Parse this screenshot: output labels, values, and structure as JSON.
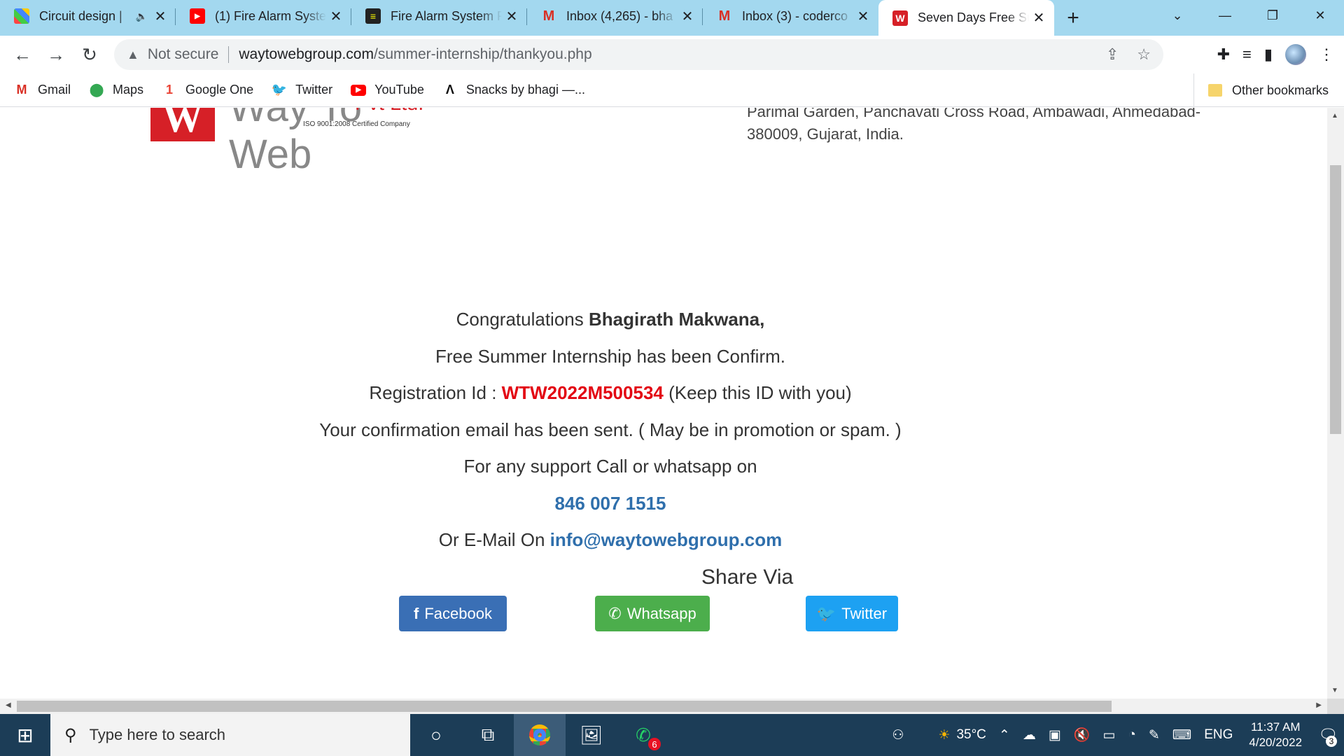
{
  "tabs": [
    {
      "title": "Circuit design |",
      "favicon": "grid-icon",
      "audio": true
    },
    {
      "title": "(1) Fire Alarm Syste",
      "favicon": "youtube-icon"
    },
    {
      "title": "Fire Alarm System F",
      "favicon": "doc-icon"
    },
    {
      "title": "Inbox (4,265) - bha",
      "favicon": "gmail-icon"
    },
    {
      "title": "Inbox (3) - coderco",
      "favicon": "gmail-icon"
    },
    {
      "title": "Seven Days Free Su",
      "favicon": "w-icon",
      "active": true
    }
  ],
  "address_bar": {
    "security": "Not secure",
    "host": "waytowebgroup.com",
    "path": "/summer-internship/thankyou.php"
  },
  "bookmarks": [
    {
      "label": "Gmail",
      "icon": "gmail-icon"
    },
    {
      "label": "Maps",
      "icon": "maps-icon"
    },
    {
      "label": "Google One",
      "icon": "google-one-icon"
    },
    {
      "label": "Twitter",
      "icon": "twitter-icon"
    },
    {
      "label": "YouTube",
      "icon": "youtube-icon"
    },
    {
      "label": "Snacks by bhagi —...",
      "icon": "snacks-icon"
    }
  ],
  "other_bookmarks": "Other bookmarks",
  "logo": {
    "letter": "W",
    "brand": "Way To Web",
    "pvt": "Pvt Ltd.",
    "iso": "ISO 9001:2008 Certified Company"
  },
  "address_lines": [
    "Parimal Garden, Panchavati Cross Road, Ambawadi, Ahmedabad-",
    "380009, Gujarat, India."
  ],
  "message": {
    "congrats_prefix": "Congratulations ",
    "name": "Bhagirath Makwana,",
    "confirm": "Free Summer Internship has been Confirm.",
    "reg_prefix": "Registration Id : ",
    "reg_id": "WTW2022M500534",
    "reg_suffix": " (Keep this ID with you)",
    "email_sent": "Your confirmation email has been sent. ( May be in promotion or spam. )",
    "support": "For any support Call or whatsapp on",
    "phone": "846 007 1515",
    "email_prefix": "Or E-Mail On ",
    "email": "info@waytowebgroup.com"
  },
  "share": {
    "label": "Share Via",
    "facebook": "Facebook",
    "whatsapp": "Whatsapp",
    "twitter": "Twitter"
  },
  "taskbar": {
    "search_placeholder": "Type here to search",
    "whatsapp_badge": "6",
    "temperature": "35°C",
    "language": "ENG",
    "time": "11:37 AM",
    "date": "4/20/2022",
    "notification_count": "3"
  }
}
